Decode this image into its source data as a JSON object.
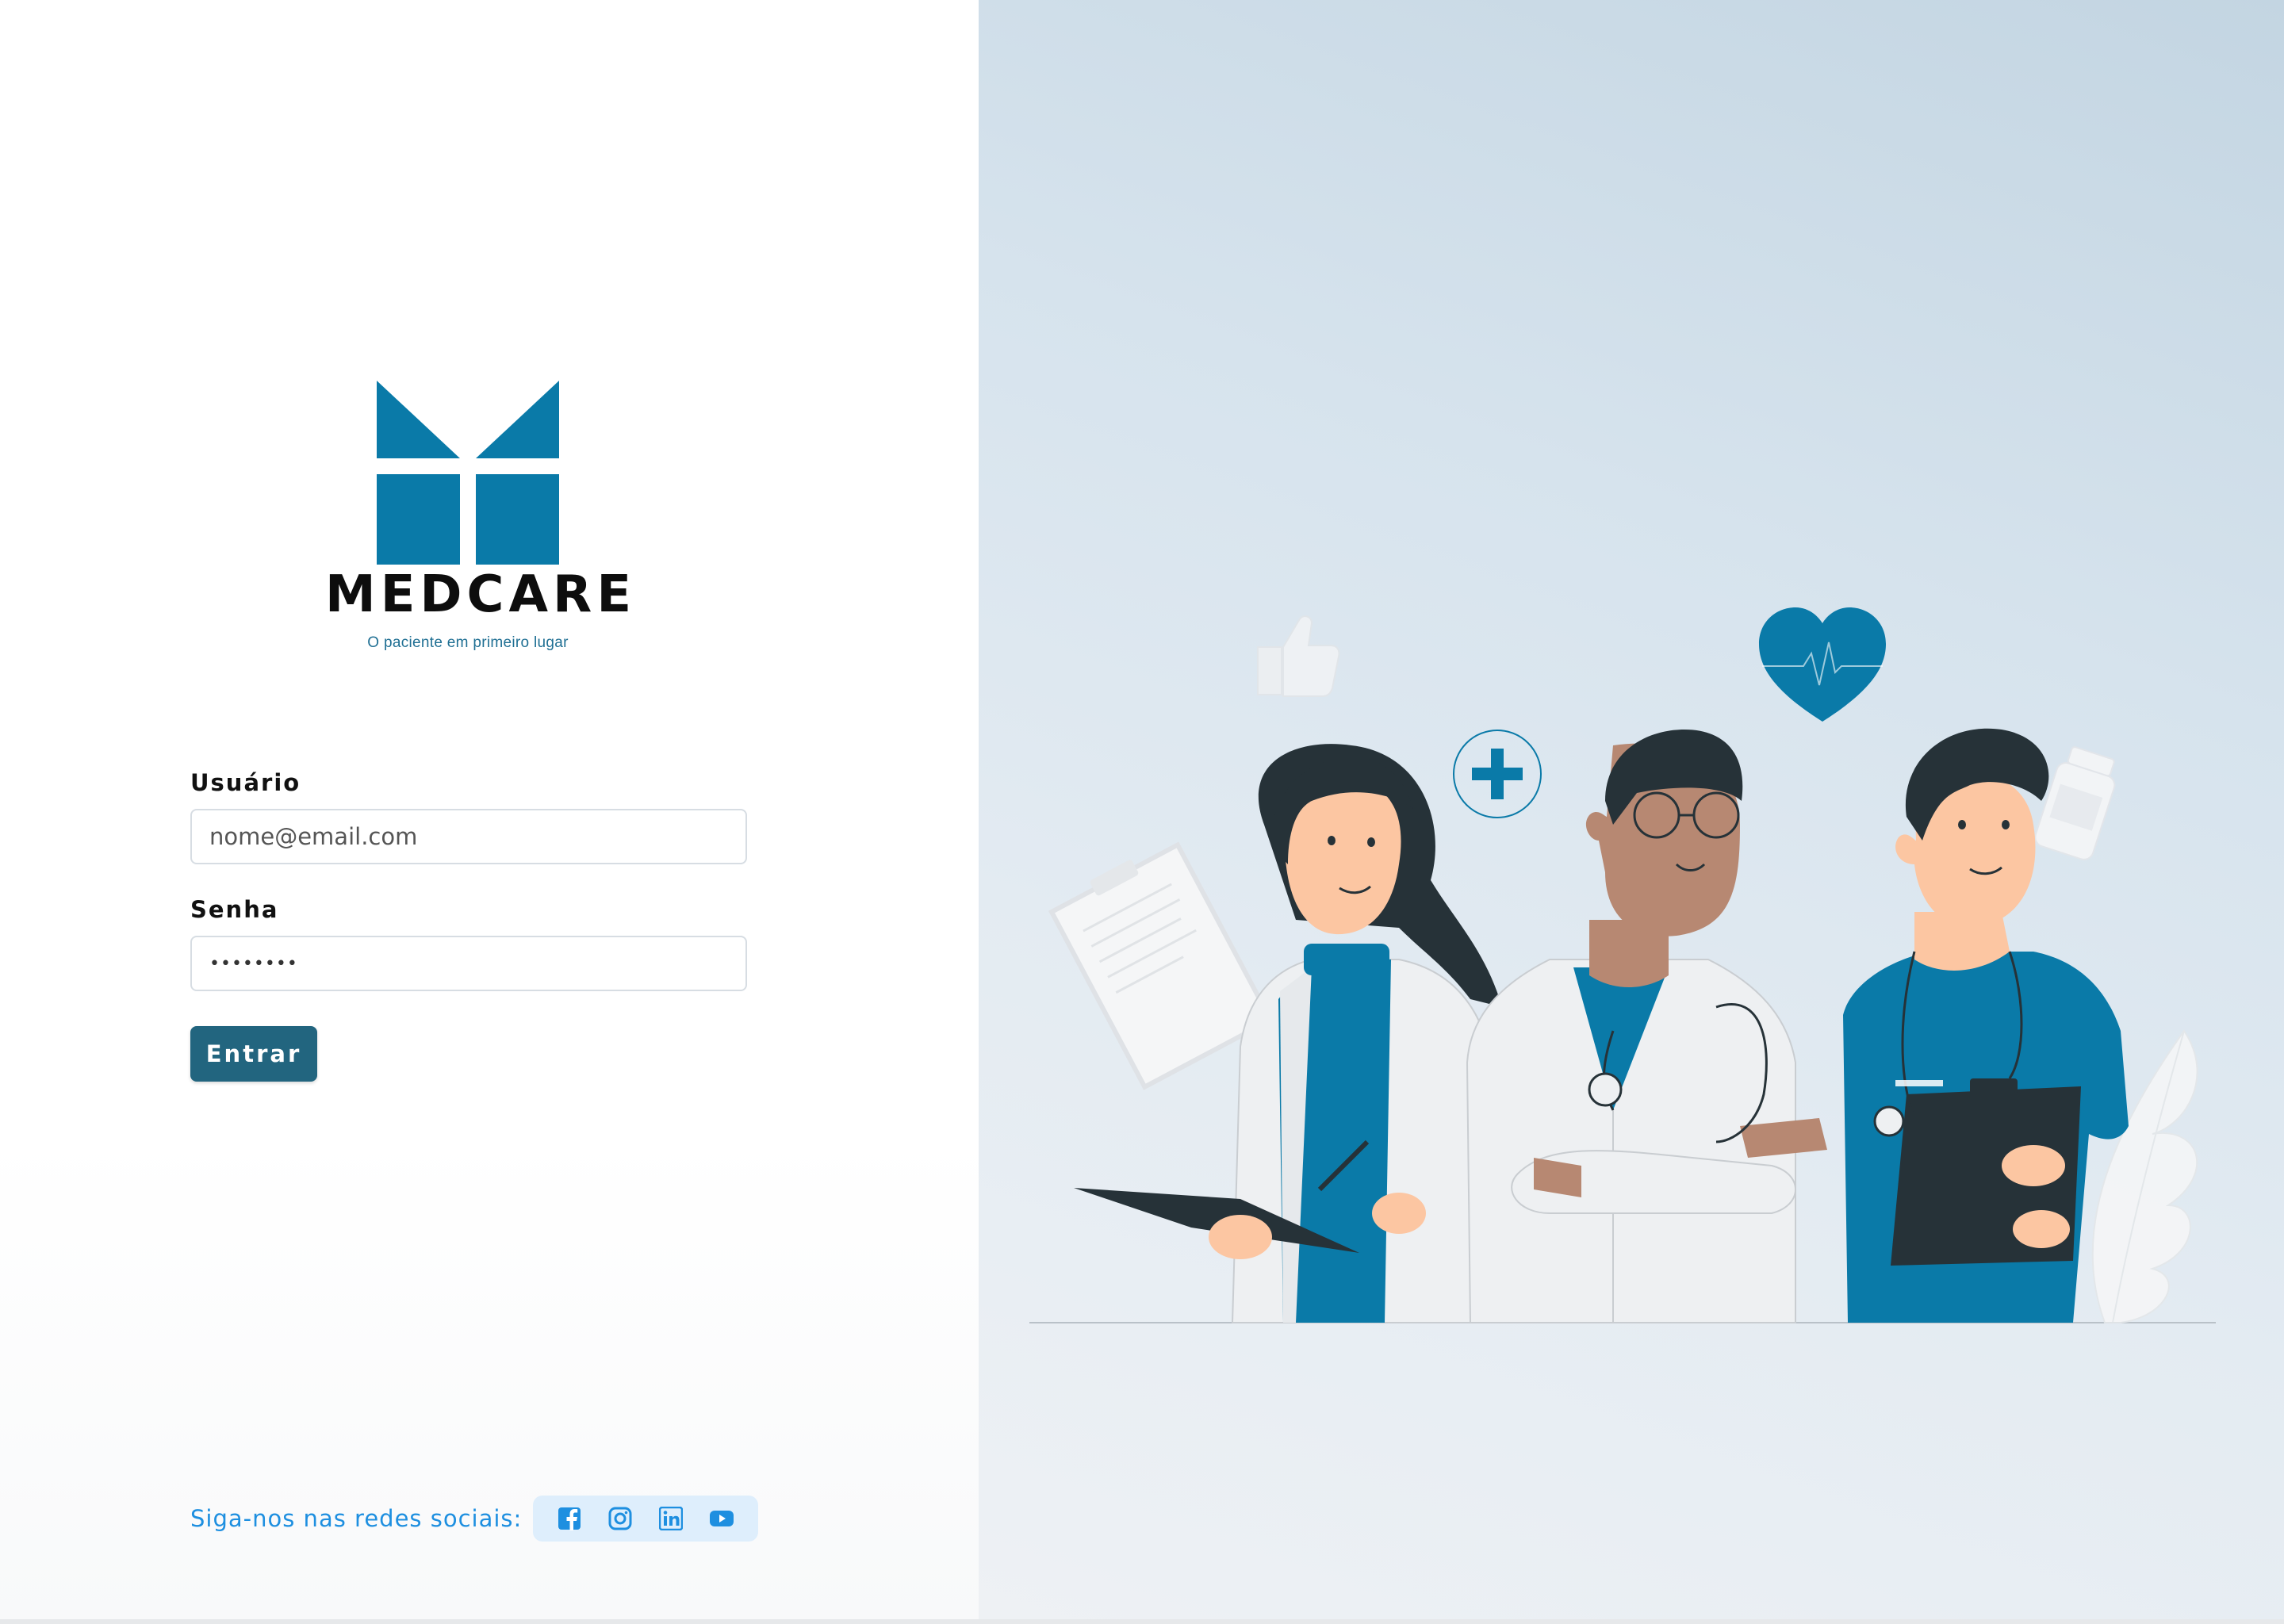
{
  "brand": {
    "name": "MEDCARE",
    "tagline": "O paciente em primeiro lugar",
    "color": "#0a7aa8"
  },
  "login_form": {
    "username": {
      "label": "Usuário",
      "placeholder": "nome@email.com",
      "value": ""
    },
    "password": {
      "label": "Senha",
      "value": "••••••••"
    },
    "submit_label": "Entrar",
    "submit_color": "#22657f"
  },
  "social": {
    "label": "Siga-nos nas redes sociais:",
    "icons": [
      "facebook-icon",
      "instagram-icon",
      "linkedin-icon",
      "youtube-icon"
    ],
    "icon_color": "#1e8fe0"
  },
  "illustration": {
    "description_icons": [
      "thumbs-up-icon",
      "heart-icon",
      "plus-icon",
      "pill-bottle-icon",
      "clipboard-icon"
    ]
  }
}
